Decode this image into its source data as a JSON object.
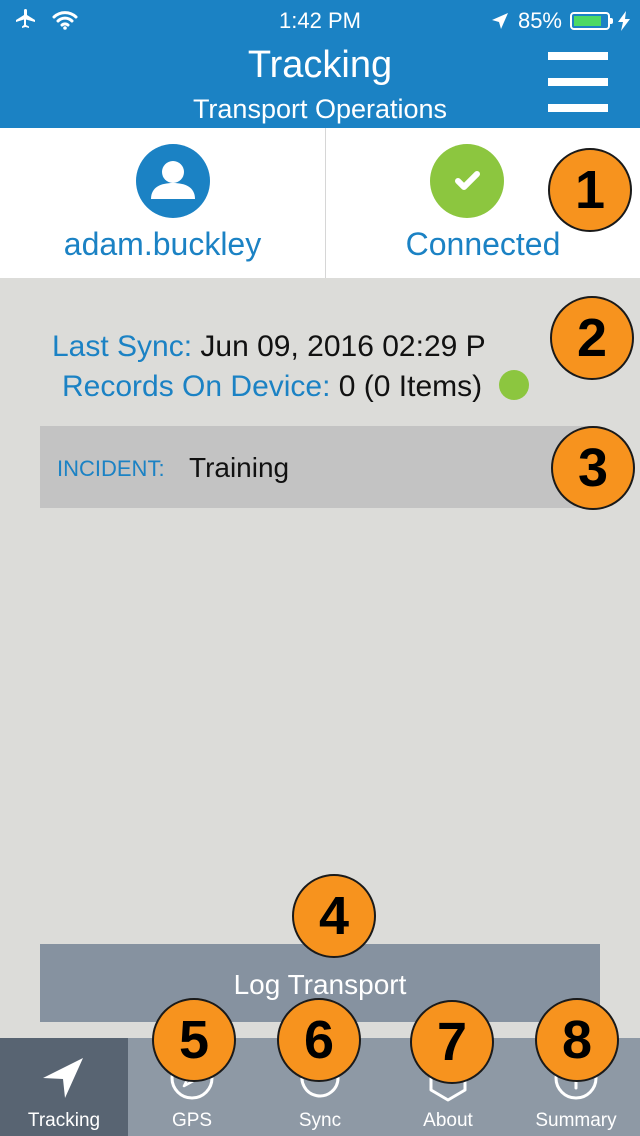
{
  "status_bar": {
    "time": "1:42 PM",
    "battery_percent": "85%",
    "battery_level": 0.85
  },
  "header": {
    "title": "Tracking",
    "subtitle": "Transport Operations"
  },
  "user": {
    "name": "adam.buckley"
  },
  "connection": {
    "status": "Connected"
  },
  "sync": {
    "last_sync_label": "Last Sync:",
    "last_sync_value": "Jun 09, 2016 02:29 P",
    "records_label": "Records On Device:",
    "records_value": "0 (0 Items)"
  },
  "incident": {
    "label": "INCIDENT:",
    "value": "Training"
  },
  "actions": {
    "log_transport": "Log Transport"
  },
  "tabs": [
    {
      "label": "Tracking",
      "icon": "navigation-arrow-icon",
      "active": true
    },
    {
      "label": "GPS",
      "icon": "compass-icon"
    },
    {
      "label": "Sync",
      "icon": "sync-icon"
    },
    {
      "label": "About",
      "icon": "about-icon"
    },
    {
      "label": "Summary",
      "icon": "info-icon"
    }
  ],
  "badges": [
    "1",
    "2",
    "3",
    "4",
    "5",
    "6",
    "7",
    "8"
  ],
  "colors": {
    "brand_blue": "#1b82c4",
    "success_green": "#8cc63f",
    "badge_orange": "#f7931e",
    "tab_active": "#586472",
    "tab_bar": "#8e99a5",
    "button_gray": "#8692a0"
  }
}
